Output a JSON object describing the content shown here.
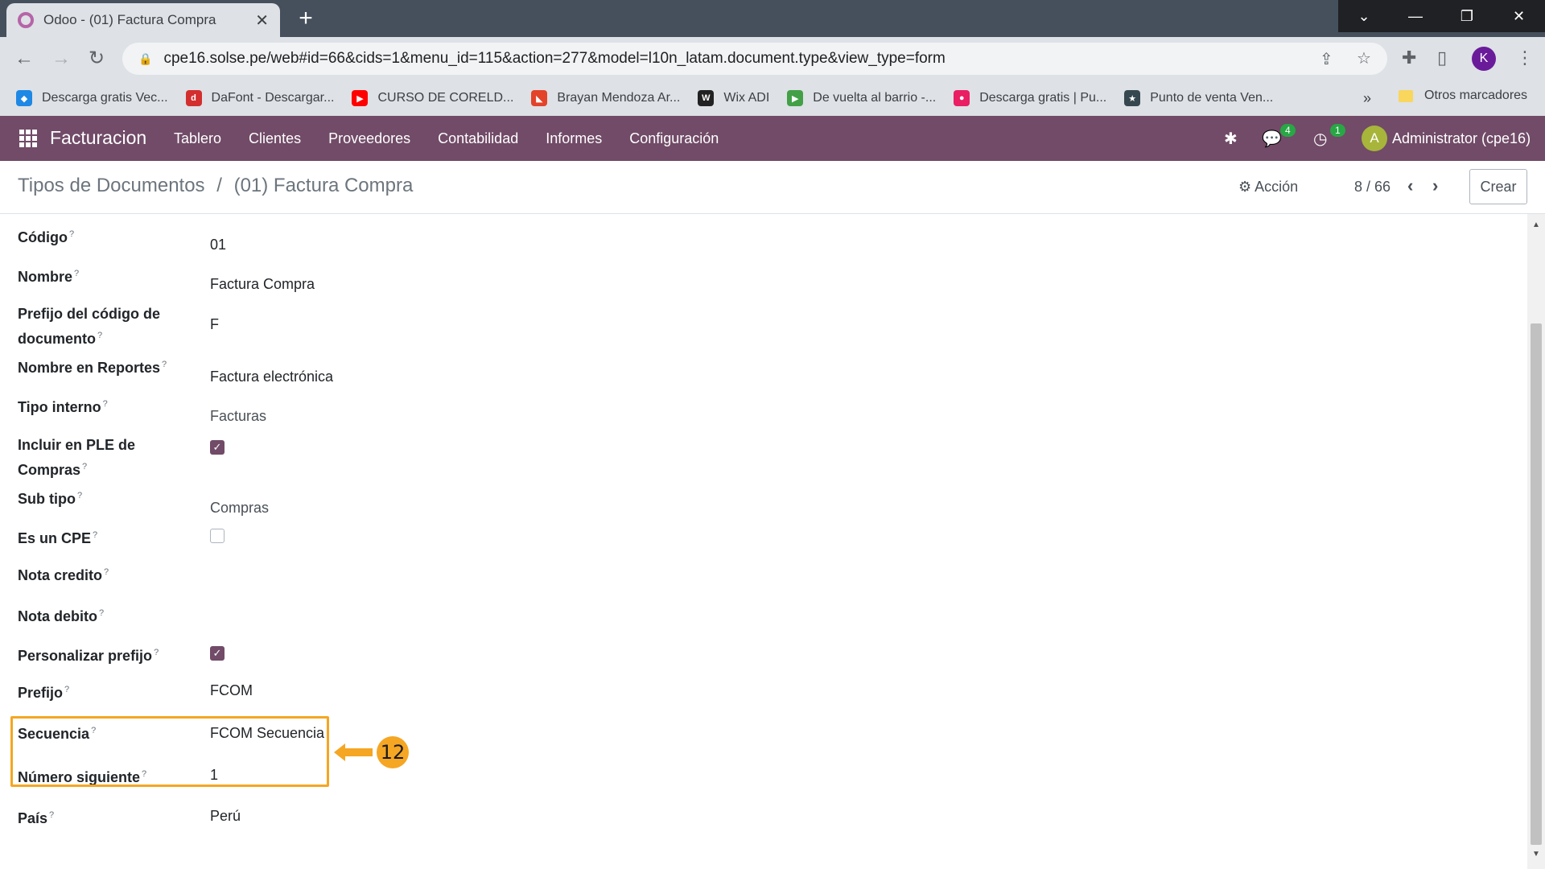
{
  "browser": {
    "tab_title": "Odoo - (01) Factura Compra",
    "url": "cpe16.solse.pe/web#id=66&cids=1&menu_id=115&action=277&model=l10n_latam.document.type&view_type=form",
    "profile_initial": "K",
    "bookmarks": [
      {
        "label": "Descarga gratis Vec...",
        "icon": "freepik-icon",
        "color": "#1e88e5"
      },
      {
        "label": "DaFont - Descargar...",
        "icon": "dafont-icon",
        "color": "#d32f2f"
      },
      {
        "label": "CURSO DE CORELD...",
        "icon": "youtube-icon",
        "color": "#ff0000"
      },
      {
        "label": "Brayan Mendoza Ar...",
        "icon": "gitlab-icon",
        "color": "#e24329"
      },
      {
        "label": "Wix ADI",
        "icon": "wix-icon",
        "color": "#222222"
      },
      {
        "label": "De vuelta al barrio -...",
        "icon": "play-icon",
        "color": "#43a047"
      },
      {
        "label": "Descarga gratis | Pu...",
        "icon": "pink-drop-icon",
        "color": "#e91e63"
      },
      {
        "label": "Punto de venta Ven...",
        "icon": "star-badge-icon",
        "color": "#37474f"
      }
    ],
    "other_bookmarks": "Otros marcadores"
  },
  "odoo": {
    "app_name": "Facturacion",
    "menu": [
      "Tablero",
      "Clientes",
      "Proveedores",
      "Contabilidad",
      "Informes",
      "Configuración"
    ],
    "messages_count": "4",
    "activities_count": "1",
    "user_initial": "A",
    "user_name": "Administrator (cpe16)",
    "brand_color": "#714b67"
  },
  "control": {
    "breadcrumb_parent": "Tipos de Documentos",
    "breadcrumb_sep": "/",
    "breadcrumb_current": "(01) Factura Compra",
    "action_label": "Acción",
    "pager": "8 / 66",
    "create_label": "Crear"
  },
  "form": {
    "codigo": {
      "label": "Código",
      "value": "01"
    },
    "nombre": {
      "label": "Nombre",
      "value": "Factura Compra"
    },
    "prefijo_codigo": {
      "label": "Prefijo del código de documento",
      "value": "F"
    },
    "nombre_reportes": {
      "label": "Nombre en Reportes",
      "value": "Factura electrónica"
    },
    "tipo_interno": {
      "label": "Tipo interno",
      "value": "Facturas"
    },
    "incluir_ple": {
      "label": "Incluir en PLE de Compras",
      "checked": true
    },
    "sub_tipo": {
      "label": "Sub tipo",
      "value": "Compras"
    },
    "es_cpe": {
      "label": "Es un CPE",
      "checked": false
    },
    "nota_credito": {
      "label": "Nota credito",
      "value": ""
    },
    "nota_debito": {
      "label": "Nota debito",
      "value": ""
    },
    "personalizar_prefijo": {
      "label": "Personalizar prefijo",
      "checked": true
    },
    "prefijo": {
      "label": "Prefijo",
      "value": "FCOM"
    },
    "secuencia": {
      "label": "Secuencia",
      "value": "FCOM Secuencia"
    },
    "numero_siguiente": {
      "label": "Número siguiente",
      "value": "1"
    },
    "pais": {
      "label": "País",
      "value": "Perú"
    }
  },
  "annotation": {
    "step_number": "12",
    "color": "#f5a623"
  }
}
